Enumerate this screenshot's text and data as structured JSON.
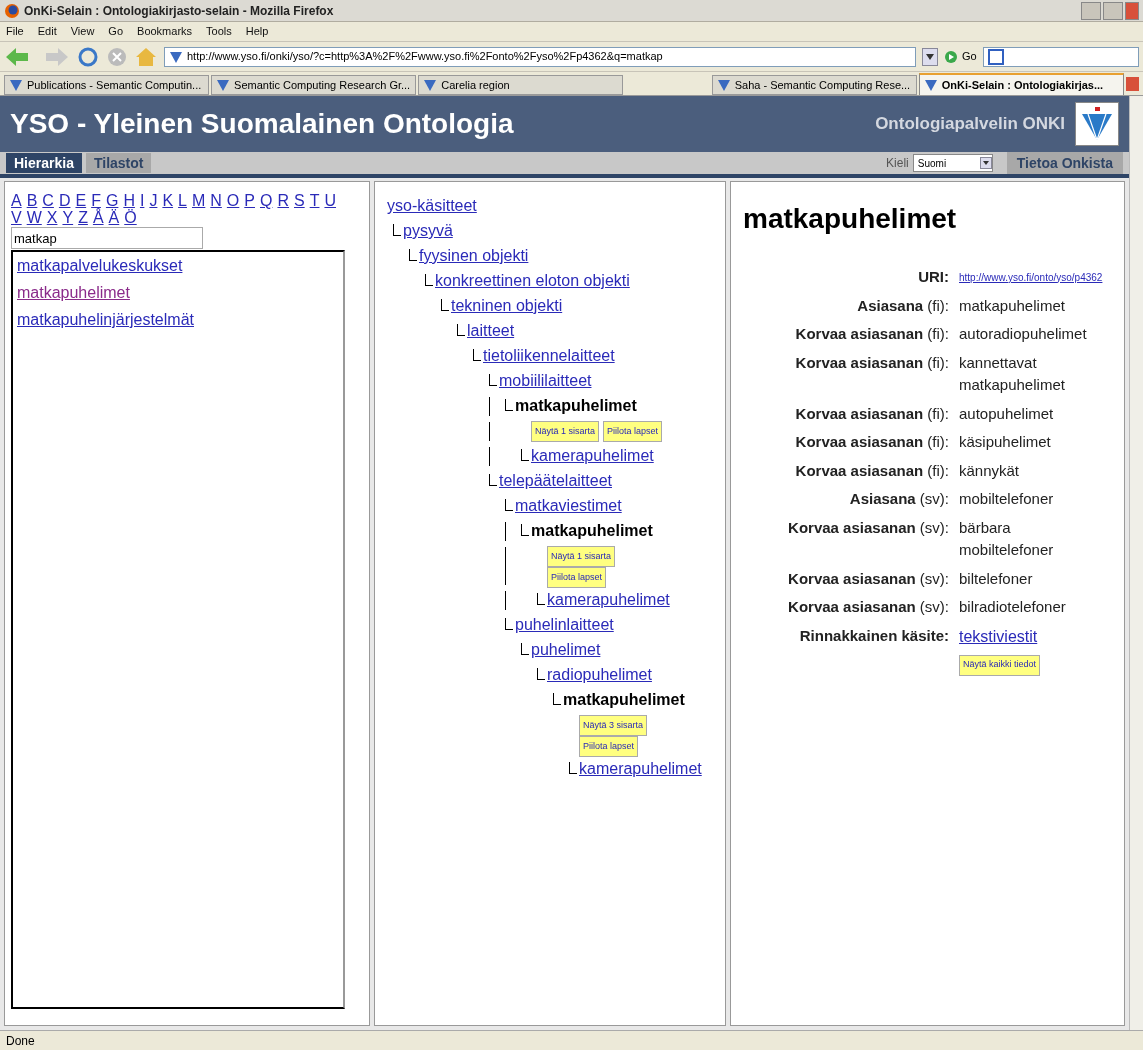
{
  "window": {
    "title": "OnKi-Selain : Ontologiakirjasto-selain - Mozilla Firefox"
  },
  "menu": [
    "File",
    "Edit",
    "View",
    "Go",
    "Bookmarks",
    "Tools",
    "Help"
  ],
  "address_bar": {
    "url": "http://www.yso.fi/onki/yso/?c=http%3A%2F%2Fwww.yso.fi%2Fonto%2Fyso%2Fp4362&q=matkap",
    "go": "Go"
  },
  "browser_tabs": [
    {
      "label": "Publications - Semantic Computin...",
      "selected": false
    },
    {
      "label": "Semantic Computing Research Gr...",
      "selected": false
    },
    {
      "label": "Carelia region",
      "selected": false
    },
    {
      "label": "Saha - Semantic Computing Rese...",
      "selected": false
    },
    {
      "label": "OnKi-Selain : Ontologiakirjas...",
      "selected": true
    }
  ],
  "header": {
    "title": "YSO - Yleinen Suomalainen Ontologia",
    "service": "Ontologiapalvelin ONKI"
  },
  "nav_tabs": [
    {
      "label": "Hierarkia",
      "selected": true
    },
    {
      "label": "Tilastot",
      "selected": false
    }
  ],
  "language": {
    "label": "Kieli",
    "value": "Suomi"
  },
  "about": "Tietoa Onkista",
  "alphabet": [
    "A",
    "B",
    "C",
    "D",
    "E",
    "F",
    "G",
    "H",
    "I",
    "J",
    "K",
    "L",
    "M",
    "N",
    "O",
    "P",
    "Q",
    "R",
    "S",
    "T",
    "U",
    "V",
    "W",
    "X",
    "Y",
    "Z",
    "Å",
    "Ä",
    "Ö"
  ],
  "search": {
    "value": "matkap"
  },
  "results": [
    {
      "label": "matkapalvelukeskukset",
      "visited": false
    },
    {
      "label": "matkapuhelimet",
      "visited": true
    },
    {
      "label": "matkapuhelinjärjestelmät",
      "visited": false
    }
  ],
  "tree": [
    {
      "label": "yso-käsitteet",
      "kind": "link",
      "children": [
        {
          "label": "pysyvä",
          "kind": "link",
          "children": [
            {
              "label": "fyysinen objekti",
              "kind": "link",
              "children": [
                {
                  "label": "konkreettinen eloton objekti",
                  "kind": "link",
                  "children": [
                    {
                      "label": "tekninen objekti",
                      "kind": "link",
                      "children": [
                        {
                          "label": "laitteet",
                          "kind": "link",
                          "children": [
                            {
                              "label": "tietoliikennelaitteet",
                              "kind": "link",
                              "children": [
                                {
                                  "label": "mobiililaitteet",
                                  "kind": "link",
                                  "children": [
                                    {
                                      "label": "matkapuhelimet",
                                      "kind": "current",
                                      "buttons": [
                                        "Näytä 1 sisarta",
                                        "Piilota lapset"
                                      ],
                                      "buttons_stacked": false,
                                      "children": [
                                        {
                                          "label": "kamerapuhelimet",
                                          "kind": "link"
                                        }
                                      ]
                                    }
                                  ]
                                },
                                {
                                  "label": "telepäätelaitteet",
                                  "kind": "link",
                                  "children": [
                                    {
                                      "label": "matkaviestimet",
                                      "kind": "link",
                                      "children": [
                                        {
                                          "label": "matkapuhelimet",
                                          "kind": "current",
                                          "buttons": [
                                            "Näytä 1 sisarta",
                                            "Piilota lapset"
                                          ],
                                          "buttons_stacked": true,
                                          "children": [
                                            {
                                              "label": "kamerapuhelimet",
                                              "kind": "link"
                                            }
                                          ]
                                        }
                                      ]
                                    },
                                    {
                                      "label": "puhelinlaitteet",
                                      "kind": "link",
                                      "children": [
                                        {
                                          "label": "puhelimet",
                                          "kind": "link",
                                          "children": [
                                            {
                                              "label": "radiopuhelimet",
                                              "kind": "link",
                                              "children": [
                                                {
                                                  "label": "matkapuhelimet",
                                                  "kind": "current",
                                                  "buttons": [
                                                    "Näytä 3 sisarta",
                                                    "Piilota lapset"
                                                  ],
                                                  "buttons_stacked": true,
                                                  "children": [
                                                    {
                                                      "label": "kamerapuhelimet",
                                                      "kind": "link"
                                                    }
                                                  ]
                                                }
                                              ]
                                            }
                                          ]
                                        }
                                      ]
                                    }
                                  ]
                                }
                              ]
                            }
                          ]
                        }
                      ]
                    }
                  ]
                }
              ]
            }
          ]
        }
      ]
    }
  ],
  "concept": {
    "title": "matkapuhelimet",
    "properties": [
      {
        "label": "**URI:**",
        "value": "http://www.yso.fi/onto/yso/p4362",
        "kind": "uri"
      },
      {
        "label": "**Asiasana** (fi):",
        "value": "matkapuhelimet",
        "kind": "text"
      },
      {
        "label": "**Korvaa asiasanan** (fi):",
        "value": "autoradiopuhelimet",
        "kind": "text"
      },
      {
        "label": "**Korvaa asiasanan** (fi):",
        "value": "kannettavat matkapuhelimet",
        "kind": "text"
      },
      {
        "label": "**Korvaa asiasanan** (fi):",
        "value": "autopuhelimet",
        "kind": "text"
      },
      {
        "label": "**Korvaa asiasanan** (fi):",
        "value": "käsipuhelimet",
        "kind": "text"
      },
      {
        "label": "**Korvaa asiasanan** (fi):",
        "value": "kännykät",
        "kind": "text"
      },
      {
        "label": "**Asiasana** (sv):",
        "value": "mobiltelefoner",
        "kind": "text"
      },
      {
        "label": "**Korvaa asiasanan** (sv):",
        "value": "bärbara mobiltelefoner",
        "kind": "text"
      },
      {
        "label": "**Korvaa asiasanan** (sv):",
        "value": "biltelefoner",
        "kind": "text"
      },
      {
        "label": "**Korvaa asiasanan** (sv):",
        "value": "bilradiotelefoner",
        "kind": "text"
      },
      {
        "label": "**Rinnakkainen käsite:**",
        "value": "tekstiviestit",
        "kind": "link"
      }
    ],
    "button": "Näytä kaikki tiedot"
  },
  "status_bar": "Done"
}
